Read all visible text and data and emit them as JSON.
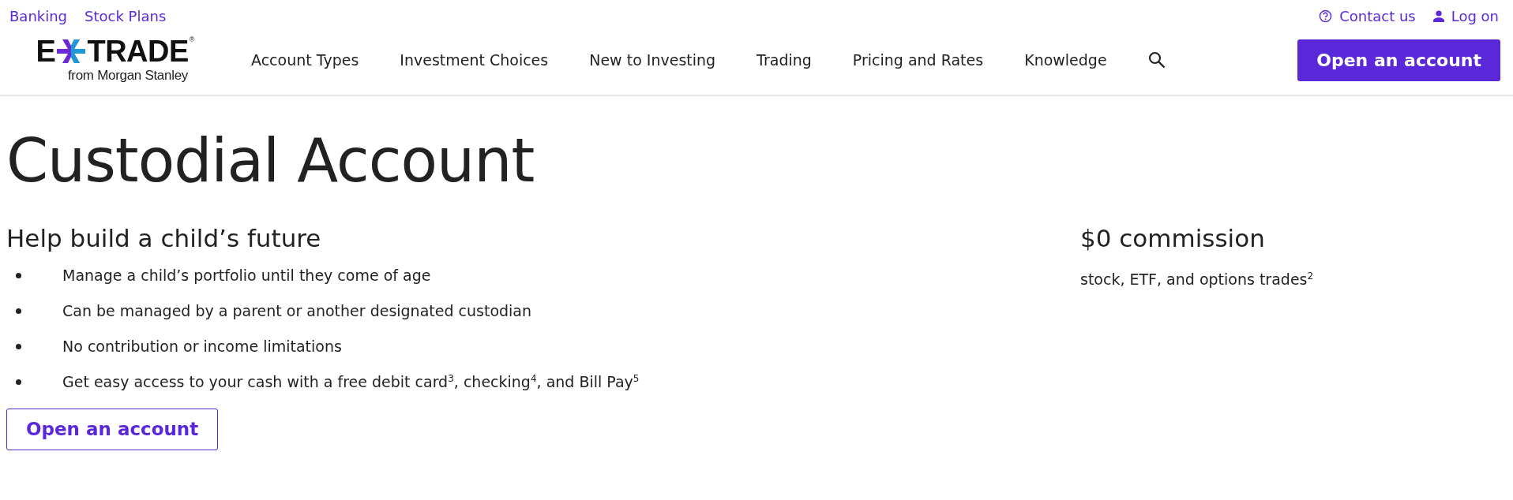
{
  "utility_nav": {
    "left": [
      "Banking",
      "Stock Plans"
    ],
    "right": [
      {
        "kind": "help",
        "label": "Contact us"
      },
      {
        "kind": "user",
        "label": "Log on"
      }
    ]
  },
  "logo": {
    "before_mark": "E",
    "after_mark": "TRADE",
    "registered": "®",
    "tagline": "from Morgan Stanley"
  },
  "main_nav": [
    "Account Types",
    "Investment Choices",
    "New to Investing",
    "Trading",
    "Pricing and Rates",
    "Knowledge"
  ],
  "header_button": "Open an account",
  "page_title": "Custodial Account",
  "benefits": {
    "heading": "Help build a child’s future",
    "bullets": [
      "Manage a child’s portfolio until they come of age",
      "Can be managed by a parent or another designated custodian",
      "No contribution or income limitations",
      "Get easy access to your cash with a free debit card$^{3}$, checking$^{4}$, and Bill Pay$^{5}$"
    ],
    "button": "Open an account"
  },
  "commission": {
    "heading": "$0 commission",
    "text": "stock, ETF, and options trades$^{2}$"
  }
}
